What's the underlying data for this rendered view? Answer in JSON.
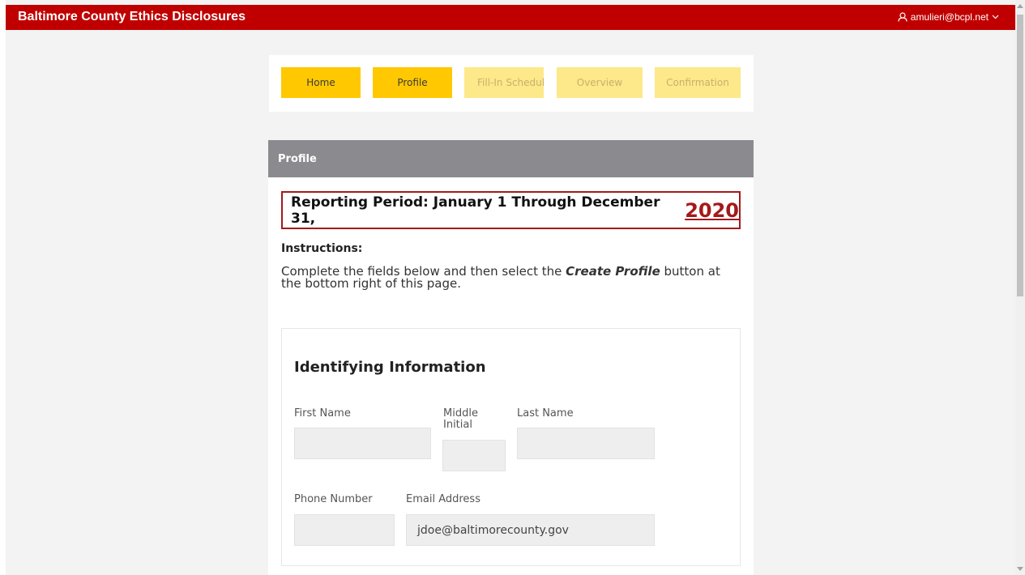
{
  "app": {
    "title": "Baltimore County Ethics Disclosures",
    "user_email": "amulieri@bcpl.net",
    "brand_color": "#c00000"
  },
  "stepper": {
    "steps": [
      {
        "label": "Home",
        "state": "active"
      },
      {
        "label": "Profile",
        "state": "active"
      },
      {
        "label": "Fill-In Schedul",
        "state": "inactive"
      },
      {
        "label": "Overview",
        "state": "inactive"
      },
      {
        "label": "Confirmation",
        "state": "inactive"
      }
    ]
  },
  "panel": {
    "title": "Profile",
    "reporting_period_text": "Reporting Period: January 1 Through December 31,",
    "reporting_year": "2020",
    "instructions_title": "Instructions:",
    "instructions_pre": "Complete the fields below and then select the ",
    "instructions_emphasis": "Create Profile",
    "instructions_post": " button at the bottom right of this page."
  },
  "identifying_info": {
    "title": "Identifying Information",
    "first_name_label": "First Name",
    "first_name_value": "",
    "middle_initial_label": "Middle Initial",
    "middle_initial_value": "",
    "last_name_label": "Last Name",
    "last_name_value": "",
    "phone_label": "Phone Number",
    "phone_value": "",
    "email_label": "Email Address",
    "email_value": "jdoe@baltimorecounty.gov"
  },
  "icons": {
    "user": "user-icon",
    "dropdown": "chevron-down-icon"
  }
}
